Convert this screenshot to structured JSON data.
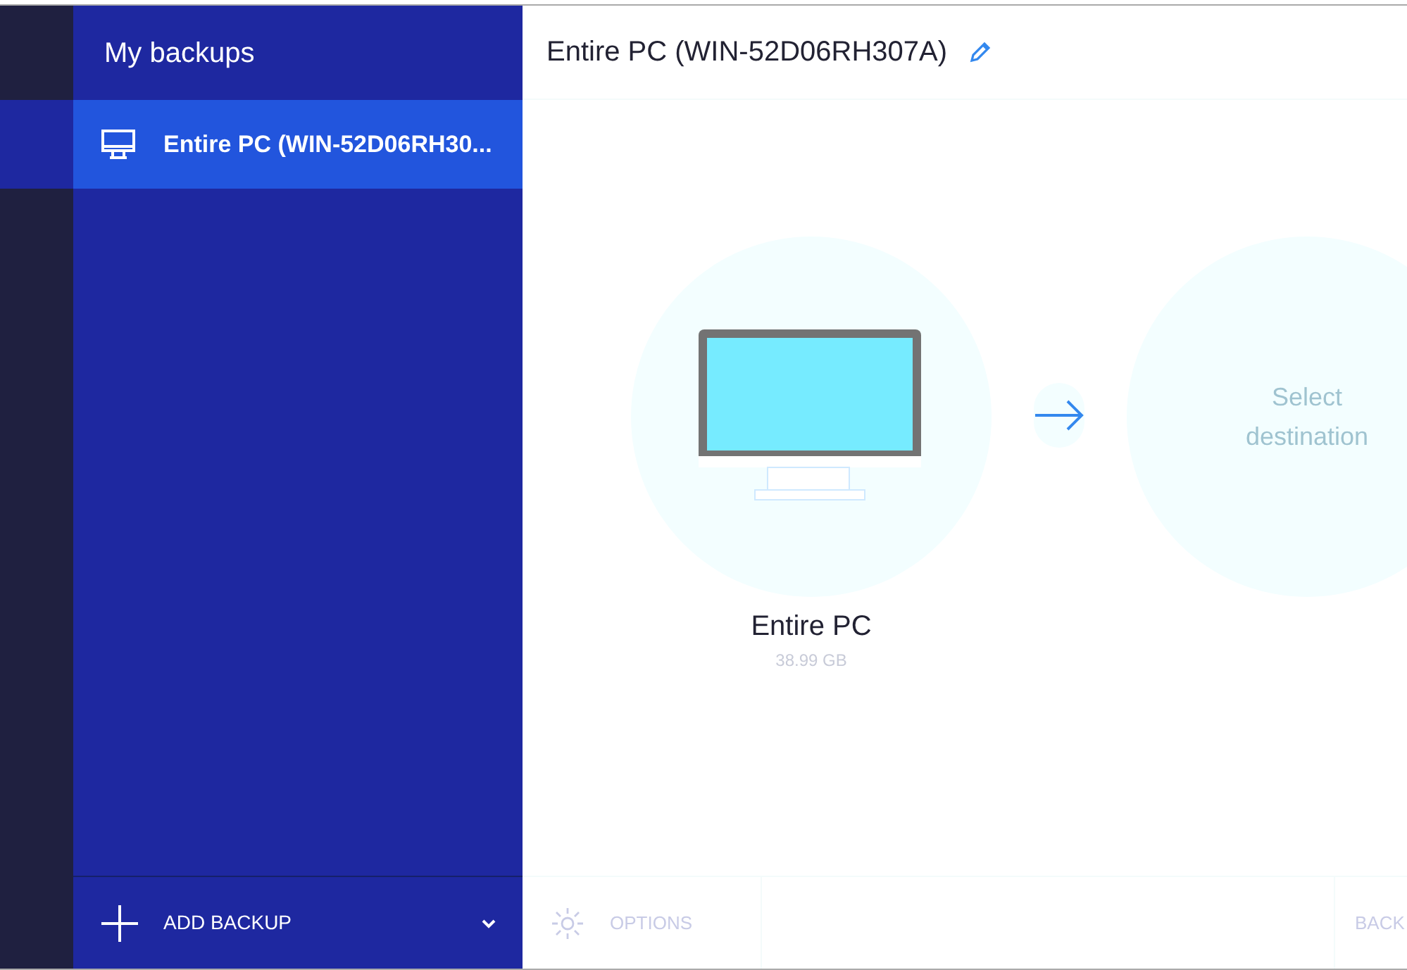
{
  "sidebar": {
    "title": "My backups",
    "items": [
      {
        "label": "Entire PC (WIN-52D06RH30...",
        "selected": true
      }
    ],
    "add_button": "ADD BACKUP"
  },
  "main": {
    "title": "Entire PC (WIN-52D06RH307A)",
    "source": {
      "label": "Entire PC",
      "size": "38.99 GB"
    },
    "destination": {
      "label": "Select destination"
    },
    "options_button": "OPTIONS",
    "back_button": "BACK"
  }
}
